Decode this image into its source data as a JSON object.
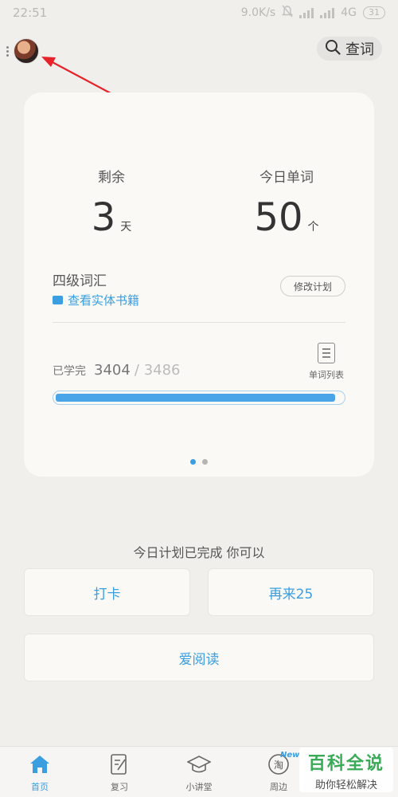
{
  "status": {
    "time": "22:51",
    "speed": "9.0K/s",
    "network": "4G",
    "battery": "31"
  },
  "header": {
    "lookup_label": "查词",
    "icons": [
      "more-dots-icon",
      "avatar",
      "search-icon"
    ]
  },
  "card": {
    "remaining_label": "剩余",
    "remaining_value": "3",
    "remaining_unit": "天",
    "today_label": "今日单词",
    "today_value": "50",
    "today_unit": "个",
    "plan_name": "四级词汇",
    "book_link": "查看实体书籍",
    "modify_label": "修改计划",
    "learned_label": "已学完",
    "learned_done": "3404",
    "learned_total": "/ 3486",
    "progress_fraction": 0.976,
    "word_list_label": "单词列表",
    "pager_active_index": 0,
    "pager_count": 2
  },
  "actions": {
    "done_message": "今日计划已完成 你可以",
    "checkin": "打卡",
    "more": "再来25",
    "reading": "爱阅读"
  },
  "tabs": [
    {
      "label": "首页",
      "icon": "home-icon",
      "active": true
    },
    {
      "label": "复习",
      "icon": "review-icon",
      "active": false
    },
    {
      "label": "小讲堂",
      "icon": "graduation-cap-icon",
      "active": false
    },
    {
      "label": "周边",
      "icon": "taobao-icon",
      "active": false
    }
  ],
  "tab_badge": "New",
  "taobao_glyph": "淘",
  "watermark": {
    "title": "百科全说",
    "subtitle": "助你轻松解决"
  },
  "colors": {
    "accent": "#3a9ee0",
    "background": "#f0efec",
    "card": "#faf9f6",
    "annotation_arrow": "#e8222a",
    "watermark_green": "#2fa84f"
  }
}
